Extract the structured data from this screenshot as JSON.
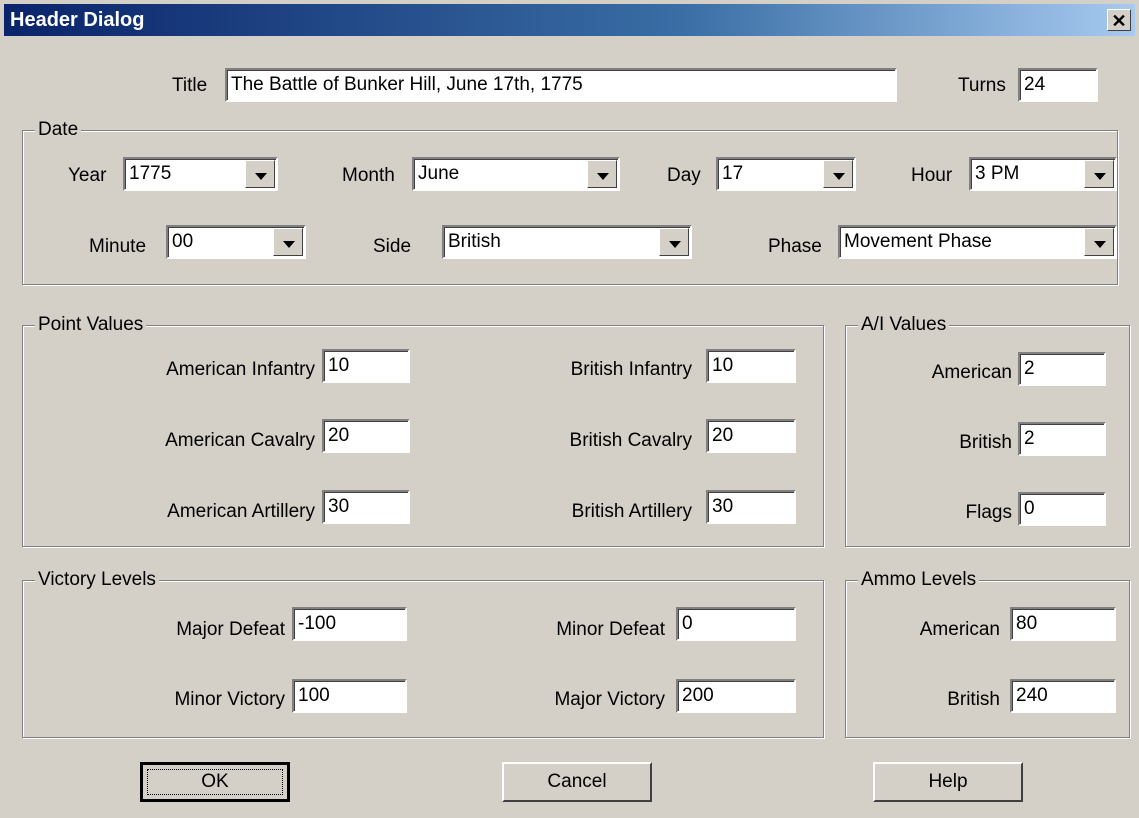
{
  "window": {
    "title": "Header Dialog",
    "close_glyph": "✕"
  },
  "header": {
    "title_label": "Title",
    "title_value": "The Battle of Bunker Hill, June 17th, 1775",
    "turns_label": "Turns",
    "turns_value": "24"
  },
  "date": {
    "legend": "Date",
    "year_label": "Year",
    "year_value": "1775",
    "month_label": "Month",
    "month_value": "June",
    "day_label": "Day",
    "day_value": "17",
    "hour_label": "Hour",
    "hour_value": "3 PM",
    "minute_label": "Minute",
    "minute_value": "00",
    "side_label": "Side",
    "side_value": "British",
    "phase_label": "Phase",
    "phase_value": "Movement Phase"
  },
  "points": {
    "legend": "Point Values",
    "american_infantry_label": "American Infantry",
    "american_infantry_value": "10",
    "american_cavalry_label": "American Cavalry",
    "american_cavalry_value": "20",
    "american_artillery_label": "American Artillery",
    "american_artillery_value": "30",
    "british_infantry_label": "British Infantry",
    "british_infantry_value": "10",
    "british_cavalry_label": "British Cavalry",
    "british_cavalry_value": "20",
    "british_artillery_label": "British Artillery",
    "british_artillery_value": "30"
  },
  "ai": {
    "legend": "A/I Values",
    "american_label": "American",
    "american_value": "2",
    "british_label": "British",
    "british_value": "2",
    "flags_label": "Flags",
    "flags_value": "0"
  },
  "victory": {
    "legend": "Victory Levels",
    "major_defeat_label": "Major Defeat",
    "major_defeat_value": "-100",
    "minor_defeat_label": "Minor Defeat",
    "minor_defeat_value": "0",
    "minor_victory_label": "Minor Victory",
    "minor_victory_value": "100",
    "major_victory_label": "Major Victory",
    "major_victory_value": "200"
  },
  "ammo": {
    "legend": "Ammo Levels",
    "american_label": "American",
    "american_value": "80",
    "british_label": "British",
    "british_value": "240"
  },
  "buttons": {
    "ok": "OK",
    "cancel": "Cancel",
    "help": "Help"
  }
}
